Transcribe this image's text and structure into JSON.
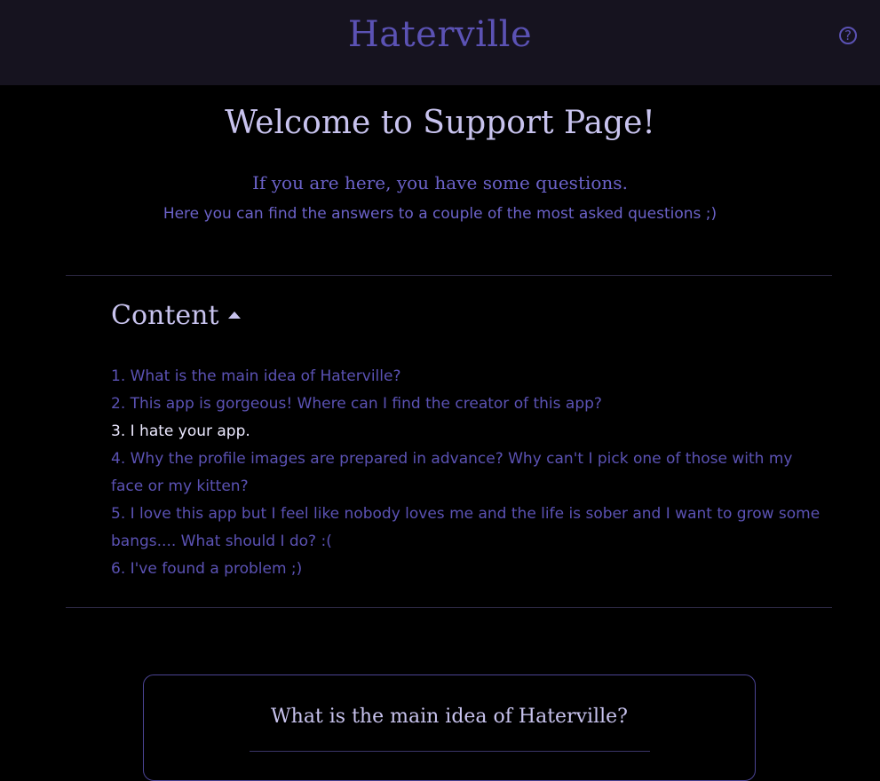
{
  "header": {
    "brand": "Haterville",
    "help_icon": "question-circle-icon",
    "help_glyph": "?"
  },
  "intro": {
    "title": "Welcome to Support Page!",
    "subtitle": "If you are here, you have some questions.",
    "note": "Here you can find the answers to a couple of the most asked questions ;)"
  },
  "toc": {
    "heading": "Content",
    "toggle_icon": "caret-up-icon",
    "items": [
      "1. What is the main idea of Haterville?",
      "2. This app is gorgeous! Where can I find the creator of this app?",
      "3. I hate your app.",
      "4. Why the profile images are prepared in advance? Why can't I pick one of those with my face or my kitten?",
      "5. I love this app but I feel like nobody loves me and the life is sober and I want to grow some bangs.... What should I do? :(",
      "6. I've found a problem ;)"
    ]
  },
  "card": {
    "title": "What is the main idea of Haterville?"
  },
  "colors": {
    "background": "#000000",
    "topbar": "#16131f",
    "accent": "#5b52b4",
    "heading": "#c8c3ee",
    "active_item": "#ece9ff"
  }
}
